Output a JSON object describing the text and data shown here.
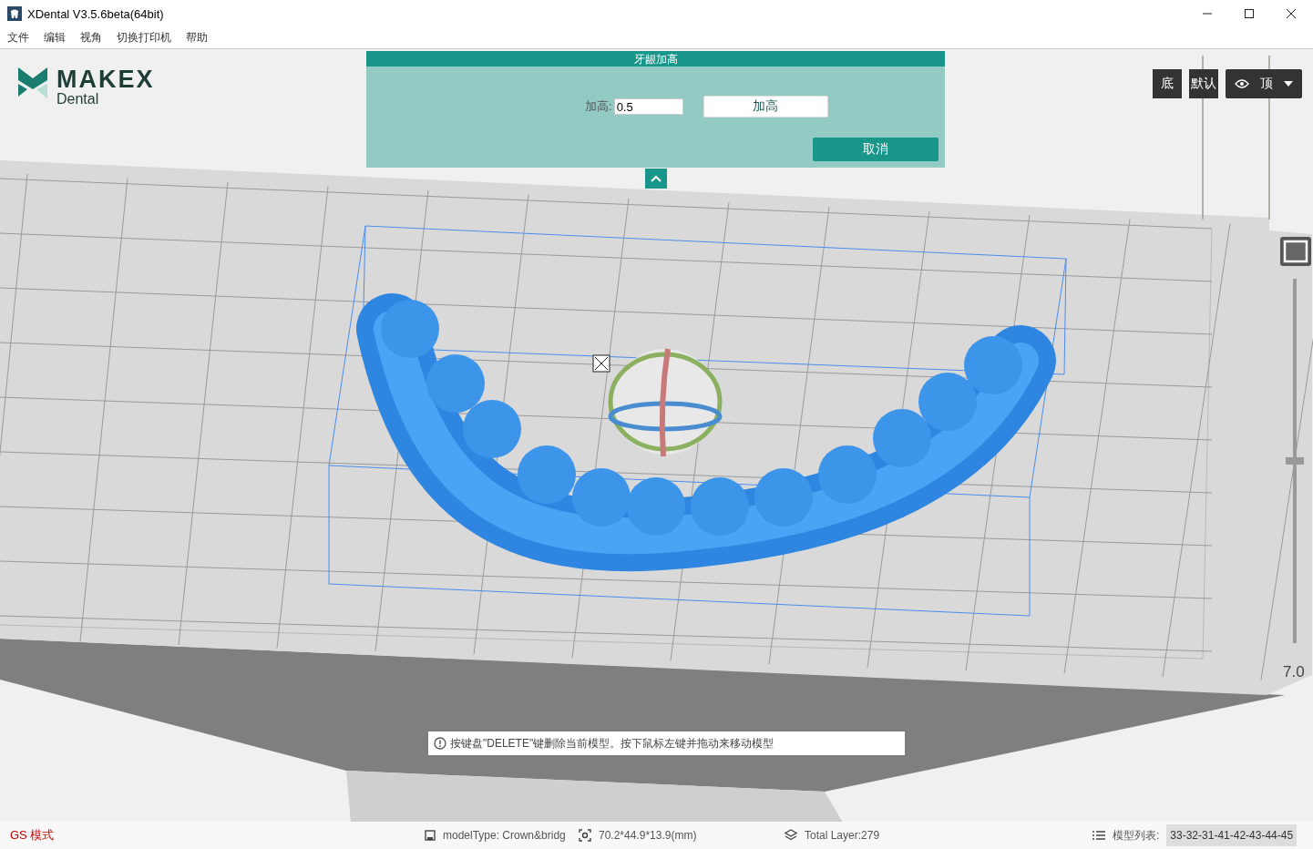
{
  "window": {
    "title": "XDental V3.5.6beta(64bit)"
  },
  "menu": [
    "文件",
    "编辑",
    "视角",
    "切换打印机",
    "帮助"
  ],
  "logo": {
    "brand": "MAKEX",
    "product": "Dental"
  },
  "dialog": {
    "title": "牙龈加高",
    "field_label": "加高:",
    "field_value": "0.5",
    "apply_button": "加高",
    "cancel_button": "取消"
  },
  "view_buttons": [
    {
      "kind": "button",
      "label": "底"
    },
    {
      "kind": "button",
      "label": "默认"
    },
    {
      "kind": "dropdown",
      "label": "顶"
    }
  ],
  "height_slider": {
    "level": 0.5,
    "reading": "7.0"
  },
  "hint": "按键盘\"DELETE\"键删除当前模型。按下鼠标左键并拖动来移动模型",
  "status_bar": {
    "mode": "GS 模式",
    "model_type": "modelType: Crown&bridg",
    "dimensions": "70.2*44.9*13.9(mm)",
    "layers": "Total Layer:279",
    "model_list_label": "模型列表:",
    "model_list": "33-32-31-41-42-43-44-45"
  }
}
